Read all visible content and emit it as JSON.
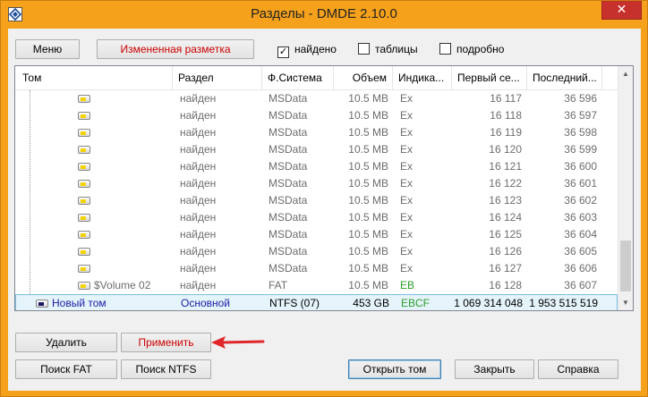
{
  "window": {
    "title": "Разделы - DMDE 2.10.0",
    "close_glyph": "✕"
  },
  "toolbar": {
    "menu_label": "Меню",
    "changed_layout_label": "Измененная разметка",
    "found_label": "найдено",
    "found_checked": true,
    "tables_label": "таблицы",
    "tables_checked": false,
    "detailed_label": "подробно",
    "detailed_checked": false,
    "check_glyph": "✓"
  },
  "table": {
    "columns": [
      "Том",
      "Раздел",
      "Ф.Система",
      "Объем",
      "Индика...",
      "Первый се...",
      "Последний..."
    ],
    "rows": [
      {
        "name": "",
        "part": "найден",
        "fs": "MSData",
        "size": "10.5 MB",
        "ind": "Ex",
        "first": "16 117",
        "last": "36 596"
      },
      {
        "name": "",
        "part": "найден",
        "fs": "MSData",
        "size": "10.5 MB",
        "ind": "Ex",
        "first": "16 118",
        "last": "36 597"
      },
      {
        "name": "",
        "part": "найден",
        "fs": "MSData",
        "size": "10.5 MB",
        "ind": "Ex",
        "first": "16 119",
        "last": "36 598"
      },
      {
        "name": "",
        "part": "найден",
        "fs": "MSData",
        "size": "10.5 MB",
        "ind": "Ex",
        "first": "16 120",
        "last": "36 599"
      },
      {
        "name": "",
        "part": "найден",
        "fs": "MSData",
        "size": "10.5 MB",
        "ind": "Ex",
        "first": "16 121",
        "last": "36 600"
      },
      {
        "name": "",
        "part": "найден",
        "fs": "MSData",
        "size": "10.5 MB",
        "ind": "Ex",
        "first": "16 122",
        "last": "36 601"
      },
      {
        "name": "",
        "part": "найден",
        "fs": "MSData",
        "size": "10.5 MB",
        "ind": "Ex",
        "first": "16 123",
        "last": "36 602"
      },
      {
        "name": "",
        "part": "найден",
        "fs": "MSData",
        "size": "10.5 MB",
        "ind": "Ex",
        "first": "16 124",
        "last": "36 603"
      },
      {
        "name": "",
        "part": "найден",
        "fs": "MSData",
        "size": "10.5 MB",
        "ind": "Ex",
        "first": "16 125",
        "last": "36 604"
      },
      {
        "name": "",
        "part": "найден",
        "fs": "MSData",
        "size": "10.5 MB",
        "ind": "Ex",
        "first": "16 126",
        "last": "36 605"
      },
      {
        "name": "",
        "part": "найден",
        "fs": "MSData",
        "size": "10.5 MB",
        "ind": "Ex",
        "first": "16 127",
        "last": "36 606"
      },
      {
        "name": "$Volume 02",
        "part": "найден",
        "fs": "FAT",
        "size": "10.5 MB",
        "ind": "EB",
        "first": "16 128",
        "last": "36 607"
      },
      {
        "name": "Новый том",
        "part": "Основной",
        "fs": "NTFS (07)",
        "size": "453 GB",
        "ind": "EBCF",
        "first": "1 069 314 048",
        "last": "1 953 515 519"
      }
    ],
    "selected_row": 12,
    "scroll_up_glyph": "▲",
    "scroll_down_glyph": "▼"
  },
  "buttons": {
    "delete_label": "Удалить",
    "apply_label": "Применить",
    "search_fat_label": "Поиск FAT",
    "search_ntfs_label": "Поиск NTFS",
    "open_volume_label": "Открыть том",
    "close_label": "Закрыть",
    "help_label": "Справка"
  },
  "colors": {
    "titlebar": "#f5a11c",
    "close_button": "#c7312b",
    "accent_red": "#cc0000",
    "selected_text": "#1a1aa6",
    "indicator_green": "#2ca02c",
    "annotation_arrow": "#e0262a"
  },
  "icons": [
    "app-icon",
    "close-icon",
    "disk-icon",
    "annotation-arrow"
  ]
}
